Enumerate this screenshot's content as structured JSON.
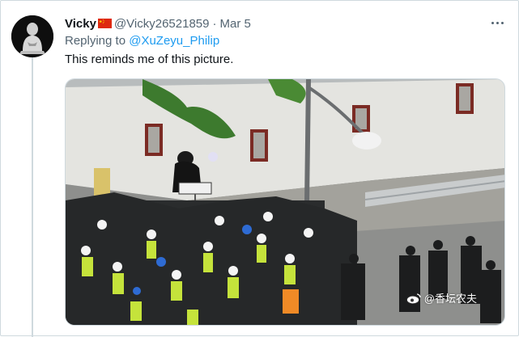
{
  "tweet": {
    "display_name": "Vicky",
    "flag_icon": "china-flag-icon",
    "handle": "@Vicky26521859",
    "separator": "·",
    "date": "Mar 5",
    "replying_prefix": "Replying to ",
    "replying_to": "@XuZeyu_Philip",
    "text": "This reminds me of this picture.",
    "more_icon": "more-options-icon"
  },
  "media": {
    "watermark": "@香坛农夫",
    "watermark_icon": "weibo-icon",
    "sign_text": "",
    "photo_description_icon": "street-protest-photo"
  },
  "colors": {
    "link": "#1d9bf0",
    "text": "#0f1419",
    "muted": "#536471",
    "border": "#cfd9de"
  }
}
